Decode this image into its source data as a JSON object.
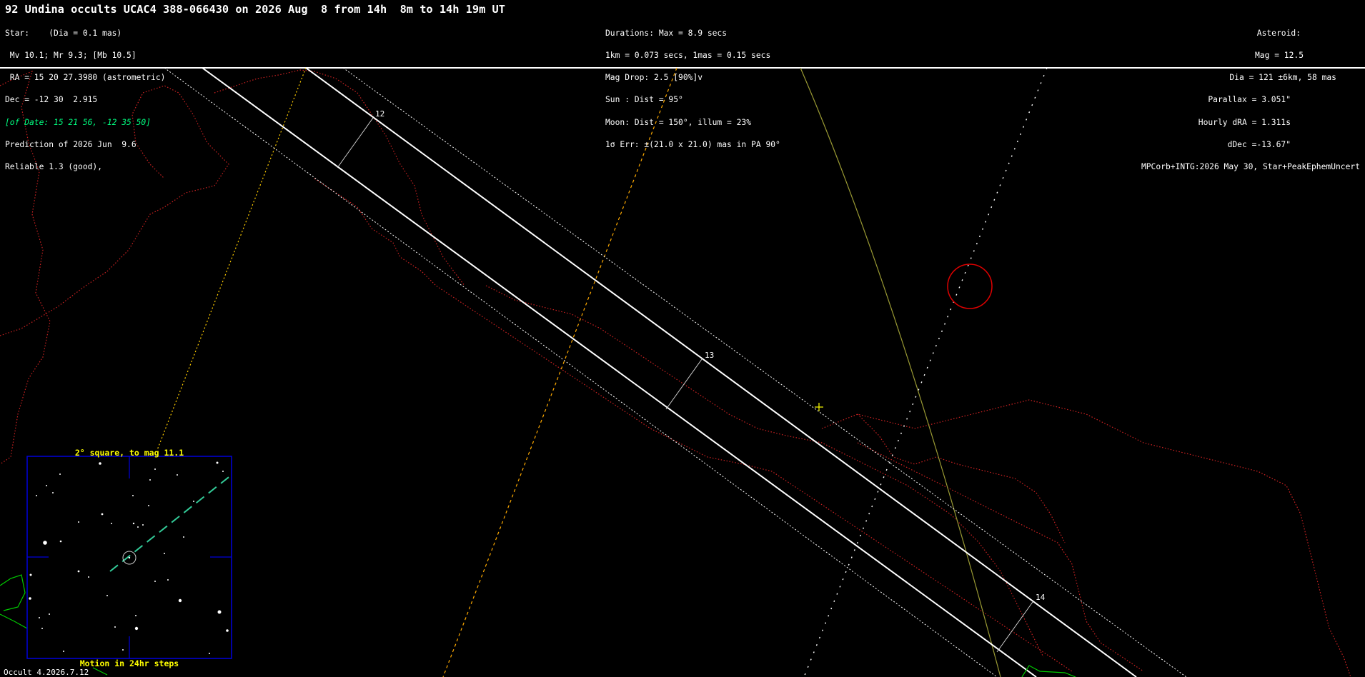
{
  "header": {
    "title": "92 Undina occults UCAC4 388-066430 on 2026 Aug  8 from 14h  8m to 14h 19m UT",
    "star": {
      "line1": "Star:    (Dia = 0.1 mas)",
      "line2": " Mv 10.1; Mr 9.3; [Mb 10.5]",
      "line3": " RA = 15 20 27.3980 (astrometric)",
      "line4": "Dec = -12 30  2.915",
      "line5": "[of Date: 15 21 56, -12 35 50]",
      "line6": "Prediction of 2026 Jun  9.6",
      "line7": "Reliable 1.3 (good),"
    },
    "event": {
      "line1": "Durations: Max = 8.9 secs",
      "line2": "1km = 0.073 secs, 1mas = 0.15 secs",
      "line3": "Mag Drop: 2.5 [90%]v",
      "line4": "Sun : Dist = 95°",
      "line5": "Moon: Dist = 150°, illum = 23%",
      "line6": "1σ Err: ±(21.0 x 21.0) mas in PA 90°"
    },
    "asteroid": {
      "line1": "Asteroid:",
      "line2": "Mag = 12.5",
      "line3": "Dia = 121 ±6km, 58 mas",
      "line4": "Parallax = 3.051\"",
      "line5": "Hourly dRA = 1.311s",
      "line6": "dDec =-13.67\"",
      "line7": "MPCorb+INTG:2026 May 30, Star+PeakEphemUncert"
    }
  },
  "path": {
    "time_labels": [
      "12",
      "13",
      "14"
    ]
  },
  "inset": {
    "title": "2° square, to mag 11.1",
    "caption": "Motion in 24hr steps"
  },
  "footer": {
    "version": "Occult 4.2026.7.12"
  },
  "colors": {
    "background": "#000000",
    "path_line": "#ffffff",
    "borders": "#cc2222",
    "coast": "#00cc00",
    "sun_terminator": "#ffcc00",
    "twilight_line": "#999933",
    "star_chart_frame": "#0000dd",
    "motion": "#33cc99",
    "error_circle": "#dd0000",
    "cross_marker": "#ffff00"
  }
}
